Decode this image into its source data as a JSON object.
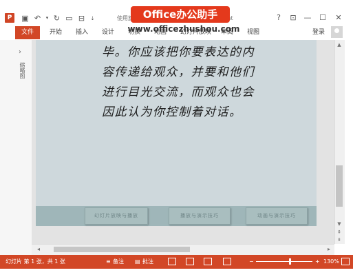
{
  "title_bar": {
    "app_logo": "P",
    "doc_title": "使用旋转的Window - 演示文稿5 - PowerPoint",
    "icons": [
      "save-icon",
      "undo-icon",
      "redo-icon",
      "start-slideshow-icon",
      "qat-icon",
      "customize-qat-icon"
    ],
    "window_buttons": {
      "help": "?",
      "ribbon_options": "⊡",
      "minimize": "—",
      "maximize": "☐",
      "close": "✕"
    }
  },
  "watermark": {
    "badge": "Office办公助手",
    "url": "www.officezhushou.com"
  },
  "ribbon": {
    "file_tab": "文件",
    "tabs": [
      "开始",
      "插入",
      "设计",
      "切换",
      "动画",
      "幻灯片放映",
      "审阅",
      "视图"
    ],
    "login": "登录"
  },
  "thumbnail_pane": {
    "label": "缩略图",
    "collapse_glyph": "›"
  },
  "slide": {
    "lines": [
      "毕。你应该把你要表达的内",
      "容传递给观众，并要和他们",
      "进行目光交流，而观众也会",
      "因此认为你控制着对话。"
    ],
    "buttons": [
      "幻灯片放映与播放",
      "播放与演示技巧",
      "动画与演示技巧"
    ]
  },
  "status_bar": {
    "slide_info": "幻灯片 第 1 张，共 1 张",
    "notes": "备注",
    "comments": "批注",
    "zoom_minus": "−",
    "zoom_plus": "+",
    "zoom_level": "130%",
    "zoom_fraction": 0.6
  },
  "colors": {
    "accent": "#d24726",
    "slide_bg": "#ced8dc",
    "slide_footer": "#9fb6b9"
  }
}
